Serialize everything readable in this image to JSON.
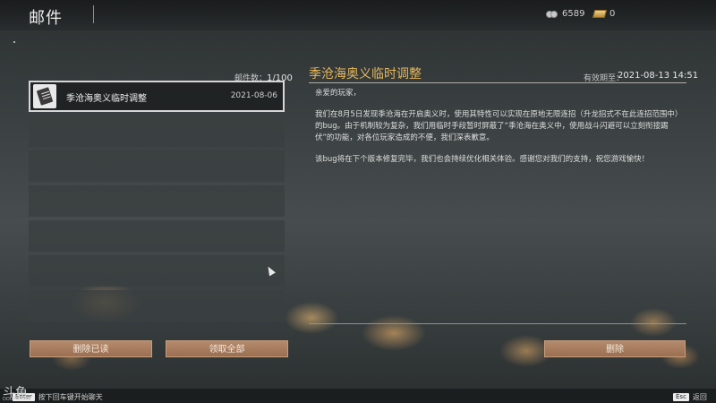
{
  "header": {
    "title": "邮件",
    "coins": "6589",
    "gold": "0"
  },
  "mail_list": {
    "count_label": "邮件数：",
    "count_value": "1/100",
    "items": [
      {
        "title": "季沧海奥义临时调整",
        "date": "2021-08-06",
        "icon": "scroll-icon"
      }
    ]
  },
  "buttons": {
    "delete_read": "删除已读",
    "claim_all": "领取全部",
    "delete": "删除"
  },
  "detail": {
    "subject": "季沧海奥义临时调整",
    "expiry_label": "有效期至：",
    "expiry_value": "2021-08-13 14:51",
    "greeting": "亲爱的玩家，",
    "para1": "我们在8月5日发现季沧海在开启奥义时，使用其特性可以实现在原地无限连招（升龙招式不在此连招范围中）的bug。由于机制较为复杂，我们用临时手段暂时屏蔽了“季沧海在奥义中，使用战斗闪避可以立刻衔接踢伏”的功能，对各位玩家造成的不便，我们深表歉意。",
    "para2": "该bug将在下个版本修复完毕，我们也会持续优化相关体验。感谢您对我们的支持，祝您游戏愉快！"
  },
  "footer": {
    "chat_key": "Enter",
    "chat_hint": "按下回车键开始聊天",
    "back_key": "Esc",
    "back_label": "返回",
    "watermark": "斗鱼",
    "watermark_url": "DOUYU.COM"
  },
  "colors": {
    "accent_gold": "#e6b75b",
    "button": "#a87c5e"
  }
}
